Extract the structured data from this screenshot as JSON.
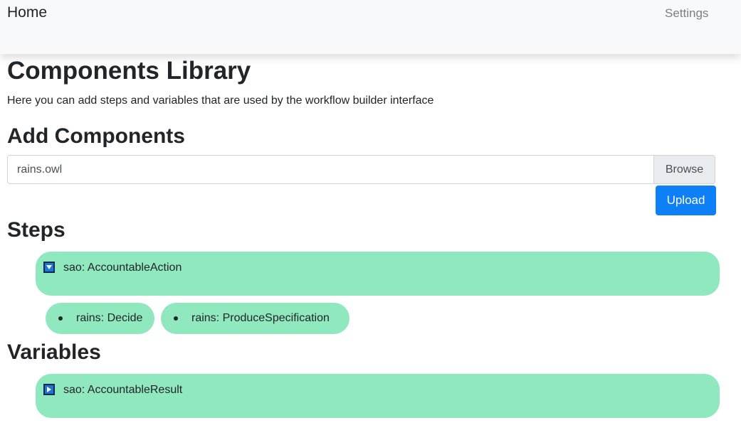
{
  "nav": {
    "home": "Home",
    "settings": "Settings"
  },
  "page": {
    "title": "Components Library",
    "intro": "Here you can add steps and variables that are used by the workflow builder interface"
  },
  "add_components": {
    "heading": "Add Components",
    "file_value": "rains.owl",
    "browse_label": "Browse",
    "upload_label": "Upload"
  },
  "steps": {
    "heading": "Steps",
    "root": {
      "label": "sao: AccountableAction",
      "expanded": true,
      "icon": "caret-down-icon"
    },
    "children": [
      {
        "label": "rains: Decide"
      },
      {
        "label": "rains: ProduceSpecification"
      }
    ]
  },
  "variables": {
    "heading": "Variables",
    "root": {
      "label": "sao: AccountableResult",
      "expanded": false,
      "icon": "caret-right-icon"
    }
  },
  "colors": {
    "navbar_bg": "#f8f9fa",
    "node_bg": "#90e8bf",
    "primary_button": "#0d7ff7",
    "toggle_icon": "#1b76d6"
  }
}
